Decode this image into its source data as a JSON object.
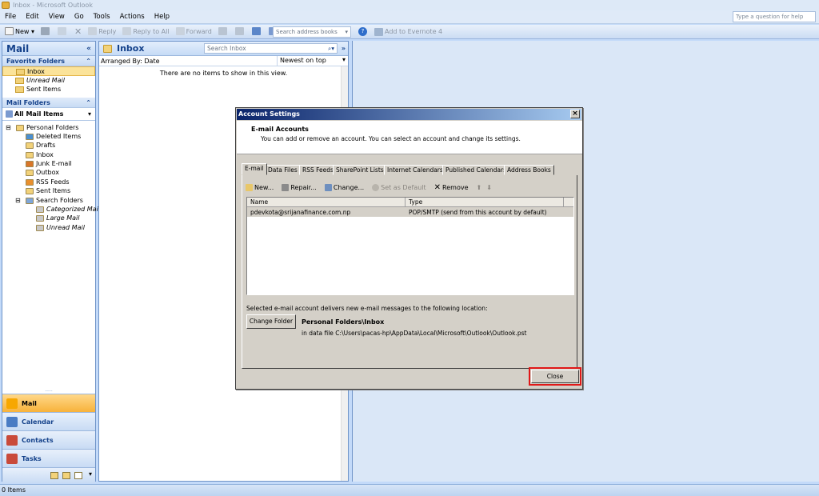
{
  "window": {
    "title": "Inbox - Microsoft Outlook"
  },
  "menu": [
    "File",
    "Edit",
    "View",
    "Go",
    "Tools",
    "Actions",
    "Help"
  ],
  "help_placeholder": "Type a question for help",
  "toolbar": {
    "new": "New",
    "reply": "Reply",
    "reply_all": "Reply to All",
    "forward": "Forward",
    "address_search": "Search address books",
    "evernote": "Add to Evernote 4"
  },
  "nav": {
    "title": "Mail",
    "favorites_header": "Favorite Folders",
    "favorites": [
      {
        "label": "Inbox",
        "italic": false
      },
      {
        "label": "Unread Mail",
        "italic": true
      },
      {
        "label": "Sent Items",
        "italic": false
      }
    ],
    "mail_folders_header": "Mail Folders",
    "all_mail": "All Mail Items",
    "tree": [
      {
        "label": "Personal Folders",
        "indent": 0,
        "italic": false
      },
      {
        "label": "Deleted Items",
        "indent": 1,
        "italic": false
      },
      {
        "label": "Drafts",
        "indent": 1,
        "italic": false
      },
      {
        "label": "Inbox",
        "indent": 1,
        "italic": false
      },
      {
        "label": "Junk E-mail",
        "indent": 1,
        "italic": false
      },
      {
        "label": "Outbox",
        "indent": 1,
        "italic": false
      },
      {
        "label": "RSS Feeds",
        "indent": 1,
        "italic": false
      },
      {
        "label": "Sent Items",
        "indent": 1,
        "italic": false
      },
      {
        "label": "Search Folders",
        "indent": 1,
        "italic": false
      },
      {
        "label": "Categorized Mail",
        "indent": 2,
        "italic": true
      },
      {
        "label": "Large Mail",
        "indent": 2,
        "italic": true
      },
      {
        "label": "Unread Mail",
        "indent": 2,
        "italic": true
      }
    ],
    "buttons": [
      {
        "label": "Mail",
        "color": "#f7a700"
      },
      {
        "label": "Calendar",
        "color": "#4a7cc4"
      },
      {
        "label": "Contacts",
        "color": "#c94a3a"
      },
      {
        "label": "Tasks",
        "color": "#c94a3a"
      }
    ]
  },
  "list": {
    "title": "Inbox",
    "search_placeholder": "Search Inbox",
    "arranged_by": "Arranged By: Date",
    "sort": "Newest on top",
    "empty": "There are no items to show in this view."
  },
  "status": {
    "text": "0 Items"
  },
  "dialog": {
    "title": "Account Settings",
    "close_x": "×",
    "heading": "E-mail Accounts",
    "desc": "You can add or remove an account. You can select an account and change its settings.",
    "tabs": [
      "E-mail",
      "Data Files",
      "RSS Feeds",
      "SharePoint Lists",
      "Internet Calendars",
      "Published Calendars",
      "Address Books"
    ],
    "actions": {
      "new": "New...",
      "repair": "Repair...",
      "change": "Change...",
      "set_default": "Set as Default",
      "remove": "Remove"
    },
    "columns": [
      "Name",
      "Type"
    ],
    "accounts": [
      {
        "name": "pdevkota@srijanafinance.com.np",
        "type": "POP/SMTP (send from this account by default)"
      }
    ],
    "delivery_text": "Selected e-mail account delivers new e-mail messages to the following location:",
    "change_folder": "Change Folder",
    "folder_path": "Personal Folders\\Inbox",
    "data_file": "in data file C:\\Users\\pacas-hp\\AppData\\Local\\Microsoft\\Outlook\\Outlook.pst",
    "close": "Close"
  },
  "colors": {
    "accent": "#15428b",
    "highlight": "#e01818"
  }
}
